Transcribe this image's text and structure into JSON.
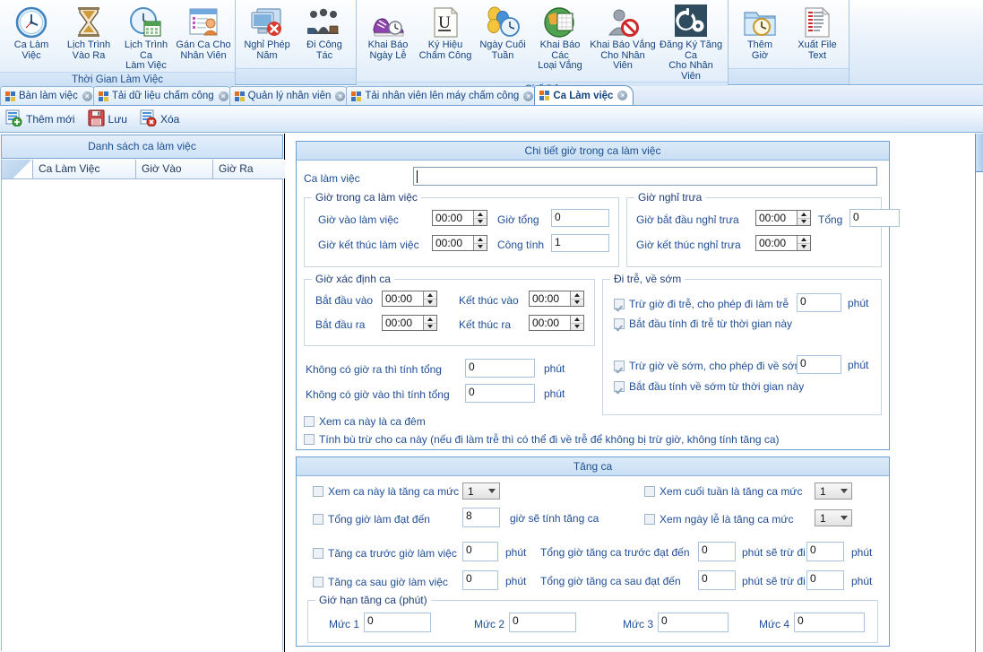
{
  "ribbon": {
    "groups": [
      {
        "caption": "Thời Gian Làm Việc",
        "buttons": [
          {
            "label": "Ca Làm\nViệc",
            "icon": "clock-icon"
          },
          {
            "label": "Lịch Trình\nVào Ra",
            "icon": "hourglass-icon"
          },
          {
            "label": "Lịch Trình Ca\nLàm Việc",
            "icon": "clock-calendar-icon"
          },
          {
            "label": "Gán Ca Cho\nNhân Viên",
            "icon": "assign-user-icon"
          }
        ]
      },
      {
        "caption": "",
        "buttons": [
          {
            "label": "Nghỉ Phép\nNăm",
            "icon": "monitor-cancel-icon"
          },
          {
            "label": "Đi Công\nTác",
            "icon": "people-group-icon"
          }
        ]
      },
      {
        "caption": "Chế Độ",
        "buttons": [
          {
            "label": "Khai Báo\nNgày Lễ",
            "icon": "shoe-clock-icon"
          },
          {
            "label": "Ký Hiệu\nChấm Công",
            "icon": "letter-u-icon"
          },
          {
            "label": "Ngày Cuối\nTuần",
            "icon": "balloons-clock-icon"
          },
          {
            "label": "Khai Báo Các\nLoại Vắng",
            "icon": "globe-calendar-icon"
          },
          {
            "label": "Khai Báo Vắng\nCho Nhân Viên",
            "icon": "user-blocked-icon"
          },
          {
            "label": "Đăng Ký Tăng Ca\nCho Nhân Viên",
            "icon": "gear-clock-icon"
          }
        ]
      },
      {
        "caption": "",
        "buttons": [
          {
            "label": "Thêm\nGiờ",
            "icon": "folder-clock-icon"
          },
          {
            "label": "Xuất File\nText",
            "icon": "text-file-icon"
          }
        ]
      }
    ]
  },
  "tabs": [
    {
      "label": "Bàn làm việc",
      "active": false
    },
    {
      "label": "Tải dữ liệu chấm công",
      "active": false
    },
    {
      "label": "Quản lý nhân viên",
      "active": false
    },
    {
      "label": "Tải nhân viên lên máy chấm công",
      "active": false
    },
    {
      "label": "Ca Làm việc",
      "active": true
    }
  ],
  "actionbar": {
    "add_label": "Thêm mới",
    "save_label": "Lưu",
    "delete_label": "Xóa"
  },
  "left_panel": {
    "header": "Danh sách ca làm việc",
    "columns": [
      "",
      "Ca Làm Việc",
      "Giờ Vào",
      "Giờ Ra"
    ],
    "rows": []
  },
  "detail": {
    "title": "Chi tiết giờ trong ca làm việc",
    "shift_name_label": "Ca làm việc",
    "shift_name_value": "",
    "work_hours": {
      "legend": "Giờ trong ca làm việc",
      "start_label": "Giờ vào làm việc",
      "start_value": "00:00",
      "end_label": "Giờ kết thúc làm việc",
      "end_value": "00:00",
      "total_label": "Giờ tổng",
      "total_value": "0",
      "credit_label": "Công tính",
      "credit_value": "1"
    },
    "lunch": {
      "legend": "Giờ nghỉ trưa",
      "start_label": "Giờ bắt đầu nghỉ trưa",
      "start_value": "00:00",
      "end_label": "Giờ kết thúc nghỉ trưa",
      "end_value": "00:00",
      "total_label": "Tổng",
      "total_value": "0"
    },
    "shift_window": {
      "legend": "Giờ xác định ca",
      "in_start_label": "Bắt đầu vào",
      "in_start_value": "00:00",
      "in_end_label": "Kết thúc vào",
      "in_end_value": "00:00",
      "out_start_label": "Bắt đầu ra",
      "out_start_value": "00:00",
      "out_end_label": "Kết thúc ra",
      "out_end_value": "00:00"
    },
    "late_early": {
      "legend": "Đi trễ, về sớm",
      "late_deduct_label": "Trừ giờ đi trễ, cho phép đi làm trễ",
      "late_deduct_checked": true,
      "late_deduct_value": "0",
      "late_deduct_unit": "phút",
      "late_from_label": "Bắt đầu tính đi trễ từ thời gian này",
      "late_from_checked": true,
      "early_deduct_label": "Trừ giờ về sớm, cho phép đi về sớm",
      "early_deduct_checked": true,
      "early_deduct_value": "0",
      "early_deduct_unit": "phút",
      "early_from_label": "Bắt đầu tính về sớm từ thời gian này",
      "early_from_checked": true
    },
    "no_out_label": "Không có giờ ra thì tính tổng",
    "no_out_value": "0",
    "no_out_unit": "phút",
    "no_in_label": "Không có giờ vào thì tính tổng",
    "no_in_value": "0",
    "no_in_unit": "phút",
    "night_shift_label": "Xem ca này là ca đêm",
    "night_shift_checked": false,
    "offset_label": "Tính bù trừ cho ca này (nếu đi làm trễ thì có thể đi về trễ để không bị trừ giờ, không tính tăng ca)",
    "offset_checked": false
  },
  "overtime": {
    "title": "Tăng ca",
    "shift_ot_label": "Xem ca này là tăng ca mức",
    "shift_ot_checked": false,
    "shift_ot_level": "1",
    "weekend_ot_label": "Xem cuối tuần là tăng ca mức",
    "weekend_ot_checked": false,
    "weekend_ot_level": "1",
    "total_reach_label": "Tổng giờ làm đạt đến",
    "total_reach_checked": false,
    "total_reach_value": "8",
    "total_reach_suffix": "giờ sẽ tính tăng ca",
    "holiday_ot_label": "Xem ngày lễ là tăng ca mức",
    "holiday_ot_checked": false,
    "holiday_ot_level": "1",
    "before_label": "Tăng ca trước giờ làm việc",
    "before_checked": false,
    "before_value": "0",
    "before_unit": "phút",
    "before_total_label": "Tổng giờ tăng ca trước đạt đến",
    "before_total_value": "0",
    "before_total_unit": "phút sẽ trừ đi",
    "before_minus_value": "0",
    "before_minus_unit": "phút",
    "after_label": "Tăng ca sau giờ làm việc",
    "after_checked": false,
    "after_value": "0",
    "after_unit": "phút",
    "after_total_label": "Tổng giờ tăng ca sau đạt đến",
    "after_total_value": "0",
    "after_total_unit": "phút sẽ trừ đi",
    "after_minus_value": "0",
    "after_minus_unit": "phút",
    "limits": {
      "legend": "Giớ hạn tăng ca (phút)",
      "l1_label": "Mức 1",
      "l1_value": "0",
      "l2_label": "Mức 2",
      "l2_value": "0",
      "l3_label": "Mức 3",
      "l3_value": "0",
      "l4_label": "Mức 4",
      "l4_value": "0"
    }
  }
}
